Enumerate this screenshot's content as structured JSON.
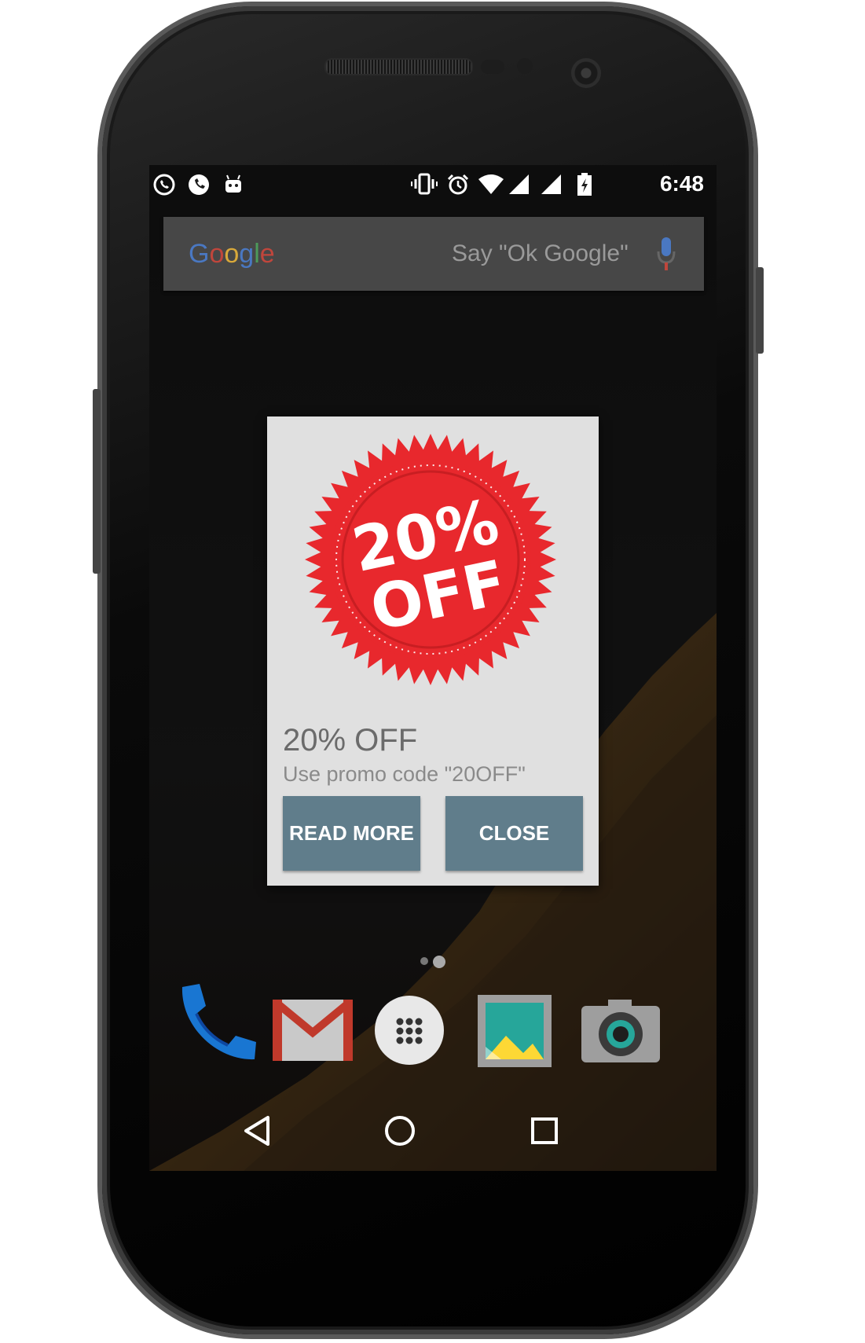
{
  "status_bar": {
    "notification_icons": [
      "whatsapp-icon",
      "phone-call-icon",
      "android-icon"
    ],
    "system_icons": [
      "vibrate-icon",
      "alarm-icon",
      "wifi-icon",
      "signal-icon",
      "signal-icon",
      "battery-charging-icon"
    ],
    "time": "6:48"
  },
  "search_widget": {
    "logo_text": "Google",
    "hint": "Say \"Ok Google\""
  },
  "dialog": {
    "badge_line1": "20%",
    "badge_line2": "OFF",
    "title": "20% OFF",
    "subtitle": "Use promo code \"20OFF\"",
    "read_more_label": "READ MORE",
    "close_label": "CLOSE",
    "badge_color": "#e8282d",
    "button_color": "#607d8b"
  },
  "dock": {
    "apps": [
      "phone-icon",
      "gmail-icon",
      "app-drawer-icon",
      "photos-icon",
      "camera-icon"
    ]
  },
  "nav_bar": {
    "buttons": [
      "back-icon",
      "home-icon",
      "recents-icon"
    ]
  }
}
